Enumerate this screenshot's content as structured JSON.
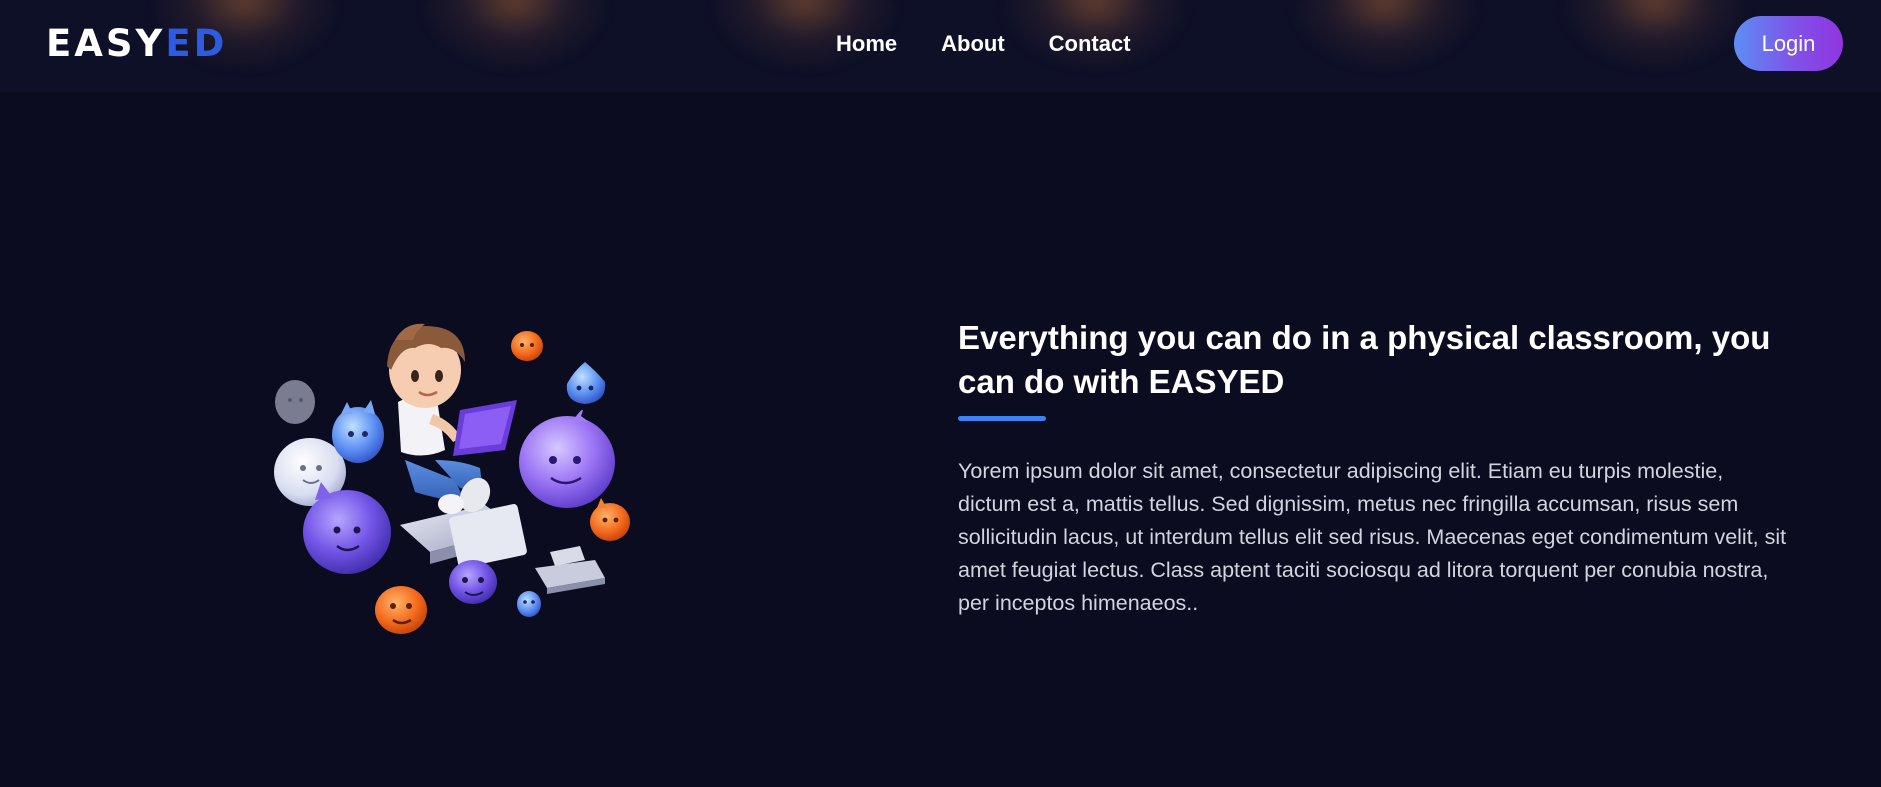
{
  "header": {
    "logo_part1": "EASY",
    "logo_part2": "ED",
    "nav": {
      "home": "Home",
      "about": "About",
      "contact": "Contact"
    },
    "login_label": "Login"
  },
  "hero": {
    "illustration_icon": "child-with-tablet-and-friendly-monsters-illustration",
    "headline": "Everything you can do in a physical classroom, you can do with EASYED",
    "body": "Yorem ipsum dolor sit amet, consectetur adipiscing elit. Etiam eu turpis molestie, dictum est a, mattis tellus. Sed dignissim, metus nec fringilla accumsan, risus sem sollicitudin lacus, ut interdum tellus elit sed risus. Maecenas eget condimentum velit, sit amet feugiat lectus. Class aptent taciti sociosqu ad litora torquent per conubia nostra, per inceptos himenaeos.."
  },
  "colors": {
    "background": "#0b0c1f",
    "header_background": "#0e1027",
    "accent_blue": "#3b82f6",
    "logo_blue": "#2d5be3",
    "login_gradient_start": "#5d8ef5",
    "login_gradient_end": "#9035e0"
  }
}
